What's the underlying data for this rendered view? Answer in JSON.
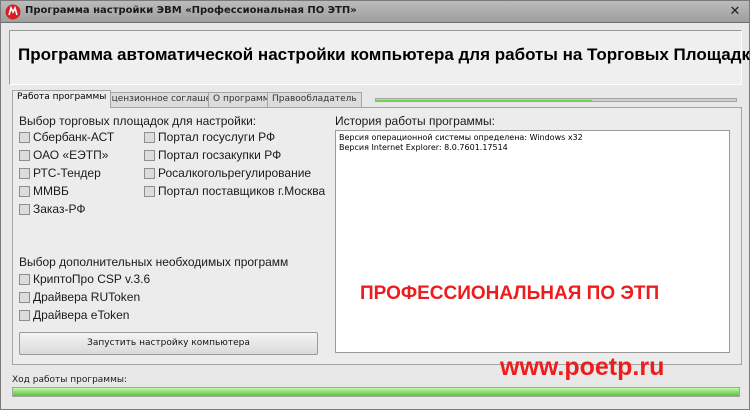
{
  "window": {
    "title": "Программа настройки ЭВМ «Профессиональная ПО ЭТП»",
    "icon": "app-logo-icon",
    "close_label": "✕"
  },
  "header": {
    "title": "Программа автоматической настройки компьютера для работы на Торговых Площадках"
  },
  "tabs": [
    {
      "label": "Работа программы",
      "active": true
    },
    {
      "label": "Лицензионное соглашение",
      "active": false
    },
    {
      "label": "О программе",
      "active": false
    },
    {
      "label": "Правообладатель",
      "active": false
    }
  ],
  "top_progress": {
    "fraction": 0.6
  },
  "platforms": {
    "label": "Выбор торговых площадок для настройки:",
    "col1": [
      "Сбербанк-АСТ",
      "ОАО «ЕЭТП»",
      "РТС-Тендер",
      "ММВБ",
      "Заказ-РФ"
    ],
    "col2": [
      "Портал госуслуги РФ",
      "Портал госзакупки РФ",
      "Росалкогольрегулирование",
      "Портал поставщиков г.Москва"
    ]
  },
  "extra_programs": {
    "label": "Выбор дополнительных необходимых программ",
    "items": [
      "КриптоПро CSP v.3.6",
      "Драйвера RUToken",
      "Драйвера eToken"
    ]
  },
  "run_button": {
    "label": "Запустить настройку компьютера"
  },
  "history": {
    "label": "История работы программы:",
    "lines": [
      "Версия операционной системы определена: Windows x32",
      "Версия Internet Explorer: 8.0.7601.17514"
    ]
  },
  "promo": {
    "headline": "ПРОФЕССИОНАЛЬНАЯ ПО ЭТП",
    "url": "www.poetp.ru",
    "color": "#ee1c1c"
  },
  "footer": {
    "progress_label": "Ход работы программы:",
    "progress_fraction": 1.0
  },
  "colors": {
    "progress_green": "#57c236",
    "window_bg": "#e8e8e8"
  }
}
